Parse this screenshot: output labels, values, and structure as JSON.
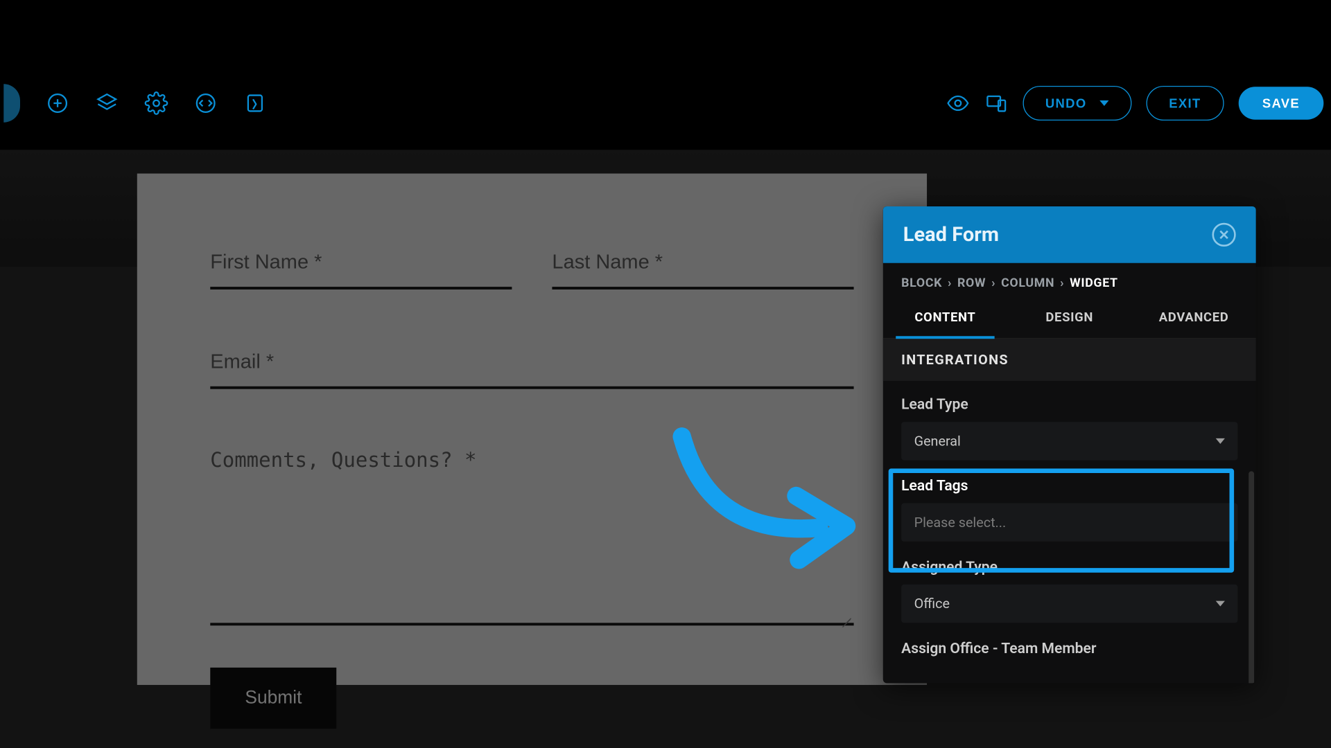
{
  "toolbar": {
    "undo_label": "UNDO",
    "exit_label": "EXIT",
    "save_label": "SAVE"
  },
  "form": {
    "first_name_placeholder": "First Name *",
    "last_name_placeholder": "Last Name *",
    "email_placeholder": "Email *",
    "comments_placeholder": "Comments, Questions? *",
    "submit_label": "Submit"
  },
  "panel": {
    "title": "Lead Form",
    "breadcrumb": {
      "block": "BLOCK",
      "row": "ROW",
      "column": "COLUMN",
      "widget": "WIDGET"
    },
    "tabs": {
      "content": "CONTENT",
      "design": "DESIGN",
      "advanced": "ADVANCED"
    },
    "section_integrations": "INTEGRATIONS",
    "lead_type": {
      "label": "Lead Type",
      "value": "General"
    },
    "lead_tags": {
      "label": "Lead Tags",
      "placeholder": "Please select..."
    },
    "assigned_type": {
      "label": "Assigned Type",
      "value": "Office"
    },
    "assign_office": {
      "label": "Assign Office - Team Member"
    }
  },
  "colors": {
    "accent": "#0a90d8",
    "highlight": "#14a0f0"
  }
}
